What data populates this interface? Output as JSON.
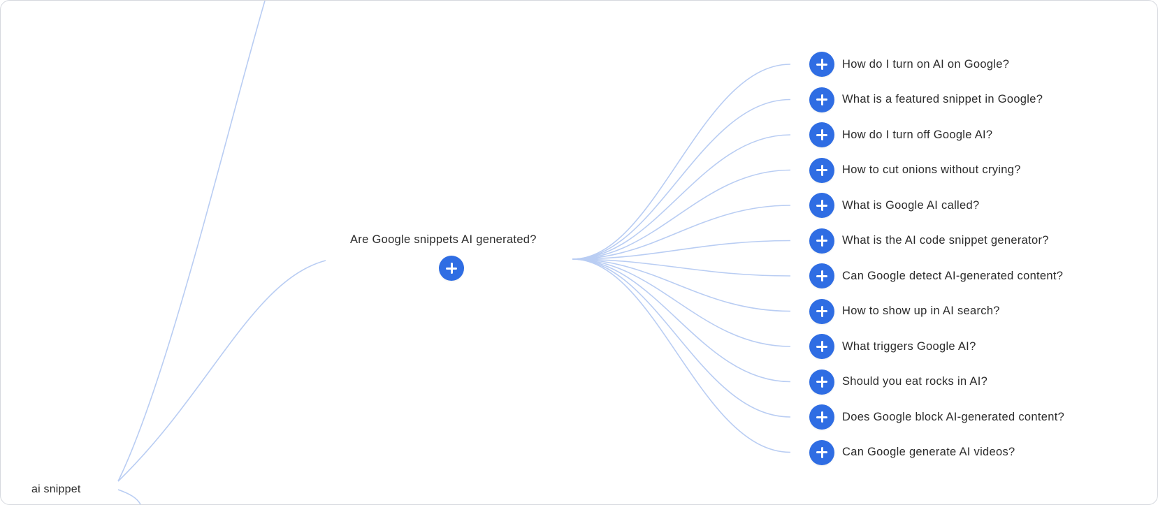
{
  "root": {
    "label": "ai snippet"
  },
  "branch": {
    "label": "Are Google snippets AI generated?",
    "expand_icon": "plus-icon"
  },
  "children": [
    {
      "label": "How do I turn on AI on Google?"
    },
    {
      "label": "What is a featured snippet in Google?"
    },
    {
      "label": "How do I turn off Google AI?"
    },
    {
      "label": "How to cut onions without crying?"
    },
    {
      "label": "What is Google AI called?"
    },
    {
      "label": "What is the AI code snippet generator?"
    },
    {
      "label": "Can Google detect AI-generated content?"
    },
    {
      "label": "How to show up in AI search?"
    },
    {
      "label": "What triggers Google AI?"
    },
    {
      "label": "Should you eat rocks in AI?"
    },
    {
      "label": "Does Google block AI-generated content?"
    },
    {
      "label": "Can Google generate AI videos?"
    }
  ],
  "colors": {
    "accent": "#2f6de3",
    "link": "#b9cdf3",
    "text": "#2b2b2b"
  }
}
